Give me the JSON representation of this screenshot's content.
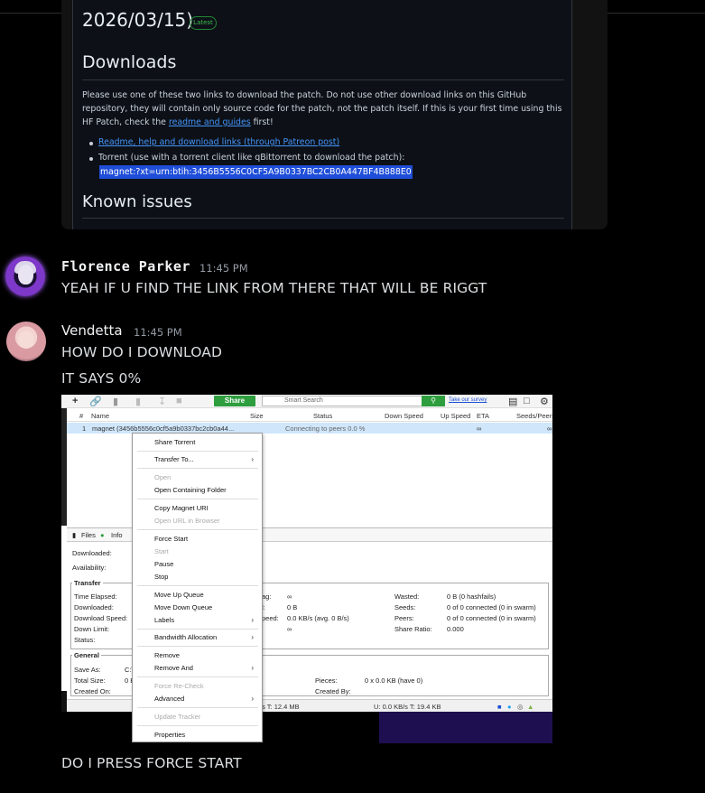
{
  "github": {
    "date": "2026/03/15)",
    "latest_badge": "Latest",
    "downloads_heading": "Downloads",
    "paragraph_text": "Please use one of these two links to download the patch. Do not use other download links on this GitHub repository, they will contain only source code for the patch, not the patch itself. If this is your first time using this HF Patch, check the ",
    "paragraph_link": "readme and guides",
    "paragraph_tail": " first!",
    "bullet1_link": "Readme, help and download links (through Patreon post)",
    "bullet2": "Torrent (use with a torrent client like qBittorrent to download the patch):",
    "magnet": "magnet:?xt=urn:btih:3456B5556C0CF5A9B0337BC2CB0A447BF4B888E0",
    "known_issues": "Known issues"
  },
  "messages": [
    {
      "user": "Florence Parker",
      "time": "11:45 PM",
      "lines": [
        "YEAH IF U FIND THE LINK FROM THERE THAT WILL BE RIGGT"
      ]
    },
    {
      "user": "Vendetta",
      "time": "11:45 PM",
      "lines": [
        "HOW DO I DOWNLOAD",
        "IT SAYS 0%"
      ],
      "after_image": "DO I PRESS FORCE START"
    }
  ],
  "qbt": {
    "share": "Share",
    "search_placeholder": "Smart Search",
    "survey": "Take our survey",
    "columns": [
      "#",
      "Name",
      "Size",
      "Status",
      "Down Speed",
      "Up Speed",
      "ETA",
      "Seeds/Peers"
    ],
    "row": {
      "num": "1",
      "name": "magnet (3456b5556c0cf5a9b0337bc2cb0a44...",
      "status": "Connecting to peers 0.0 %",
      "eta": "∞"
    },
    "tabs": {
      "files": "Files",
      "info": "Info"
    },
    "downloaded_label": "Downloaded:",
    "availability_label": "Availability:",
    "transfer": {
      "heading": "Transfer",
      "labels": [
        "Time Elapsed:",
        "Downloaded:",
        "Download Speed:",
        "Down Limit:",
        "Status:"
      ],
      "mid_labels": [
        "ag:",
        "l:",
        "peed:",
        ""
      ],
      "mid_values": [
        "∞",
        "0 B",
        "0.0 KB/s (avg. 0 B/s)",
        "∞"
      ],
      "right_labels": [
        "Wasted:",
        "Seeds:",
        "Peers:",
        "Share Ratio:"
      ],
      "right_values": [
        "0 B (0 hashfails)",
        "0 of 0 connected (0 in swarm)",
        "0 of 0 connected (0 in swarm)",
        "0.000"
      ]
    },
    "general": {
      "heading": "General",
      "labels": [
        "Save As:",
        "Total Size:",
        "Created On:"
      ],
      "values": [
        "C:\\",
        "0 B",
        ""
      ],
      "pieces_label": "Pieces:",
      "pieces_value": "0 x 0.0 KB (have 0)",
      "created_by_label": "Created By:"
    },
    "statusbar": {
      "down": "/s T: 12.4 MB",
      "up": "U: 0.0 KB/s T: 19.4 KB"
    }
  },
  "context_menu": [
    {
      "label": "Share Torrent",
      "disabled": false,
      "sub": false
    },
    {
      "label": "Transfer To...",
      "disabled": false,
      "sub": true
    },
    {
      "label": "Open",
      "disabled": true,
      "sub": false
    },
    {
      "label": "Open Containing Folder",
      "disabled": false,
      "sub": false
    },
    {
      "label": "Copy Magnet URI",
      "disabled": false,
      "sub": false
    },
    {
      "label": "Open URL in Browser",
      "disabled": true,
      "sub": false
    },
    {
      "label": "Force Start",
      "disabled": false,
      "sub": false
    },
    {
      "label": "Start",
      "disabled": true,
      "sub": false
    },
    {
      "label": "Pause",
      "disabled": false,
      "sub": false
    },
    {
      "label": "Stop",
      "disabled": false,
      "sub": false
    },
    {
      "label": "Move Up Queue",
      "disabled": false,
      "sub": false
    },
    {
      "label": "Move Down Queue",
      "disabled": false,
      "sub": false
    },
    {
      "label": "Labels",
      "disabled": false,
      "sub": true
    },
    {
      "label": "Bandwidth Allocation",
      "disabled": false,
      "sub": true
    },
    {
      "label": "Remove",
      "disabled": false,
      "sub": false
    },
    {
      "label": "Remove And",
      "disabled": false,
      "sub": true
    },
    {
      "label": "Force Re-Check",
      "disabled": true,
      "sub": false
    },
    {
      "label": "Advanced",
      "disabled": false,
      "sub": true
    },
    {
      "label": "Update Tracker",
      "disabled": true,
      "sub": false
    },
    {
      "label": "Properties",
      "disabled": false,
      "sub": false
    }
  ],
  "colors": {
    "background": "#000000",
    "magnet_highlight": "#1f4ed8",
    "link": "#4493f8"
  }
}
